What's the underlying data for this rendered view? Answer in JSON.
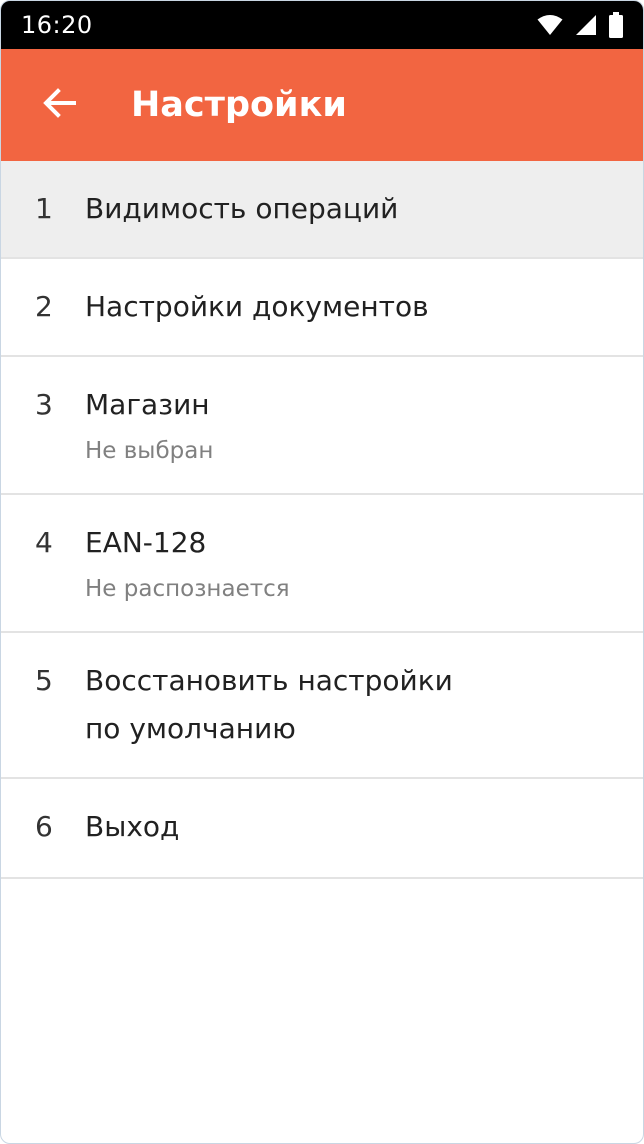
{
  "status_bar": {
    "time": "16:20",
    "icons": [
      "wifi-icon",
      "cellular-signal-icon",
      "battery-icon"
    ]
  },
  "app_bar": {
    "back_icon": "arrow-back-icon",
    "title": "Настройки",
    "color": "#f26541"
  },
  "menu": {
    "items": [
      {
        "num": "1",
        "label": "Видимость операций",
        "selected": true
      },
      {
        "num": "2",
        "label": "Настройки документов"
      },
      {
        "num": "3",
        "label": "Магазин",
        "sub": "Не выбран"
      },
      {
        "num": "4",
        "label": "EAN-128",
        "sub": "Не распознается"
      },
      {
        "num": "5",
        "label": "Восстановить настройки\nпо умолчанию"
      },
      {
        "num": "6",
        "label": "Выход"
      }
    ]
  }
}
